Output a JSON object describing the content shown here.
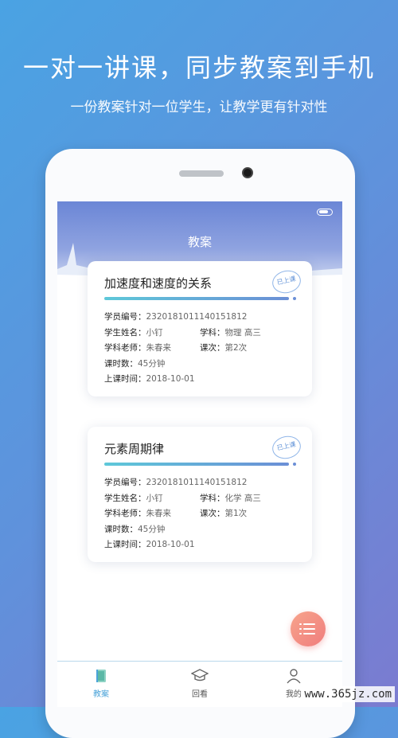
{
  "promo": {
    "headline": "一对一讲课，同步教案到手机",
    "subline": "一份教案针对一位学生，让教学更有针对性"
  },
  "app": {
    "title": "教案"
  },
  "cards": [
    {
      "title": "加速度和速度的关系",
      "stamp": "已上课",
      "progress": 1.0,
      "student_id_label": "学员编号：",
      "student_id": "2320181011140151812",
      "student_name_label": "学生姓名：",
      "student_name": "小钉",
      "subject_label": "学科：",
      "subject": "物理 高三",
      "teacher_label": "学科老师：",
      "teacher": "朱春来",
      "session_label": "课次：",
      "session": "第2次",
      "hours_label": "课时数：",
      "hours": "45分钟",
      "date_label": "上课时间：",
      "date": "2018-10-01"
    },
    {
      "title": "元素周期律",
      "stamp": "已上课",
      "progress": 1.0,
      "student_id_label": "学员编号：",
      "student_id": "2320181011140151812",
      "student_name_label": "学生姓名：",
      "student_name": "小钉",
      "subject_label": "学科：",
      "subject": "化学 高三",
      "teacher_label": "学科老师：",
      "teacher": "朱春来",
      "session_label": "课次：",
      "session": "第1次",
      "hours_label": "课时数：",
      "hours": "45分钟",
      "date_label": "上课时间：",
      "date": "2018-10-01"
    }
  ],
  "tabs": [
    {
      "label": "教案",
      "icon": "book-icon",
      "active": true
    },
    {
      "label": "回看",
      "icon": "graduation-cap-icon",
      "active": false
    },
    {
      "label": "我的",
      "icon": "person-icon",
      "active": false
    }
  ],
  "watermark": "www.365jz.com",
  "colors": {
    "accent": "#4aa3d9",
    "fab": "#f07d7d"
  }
}
